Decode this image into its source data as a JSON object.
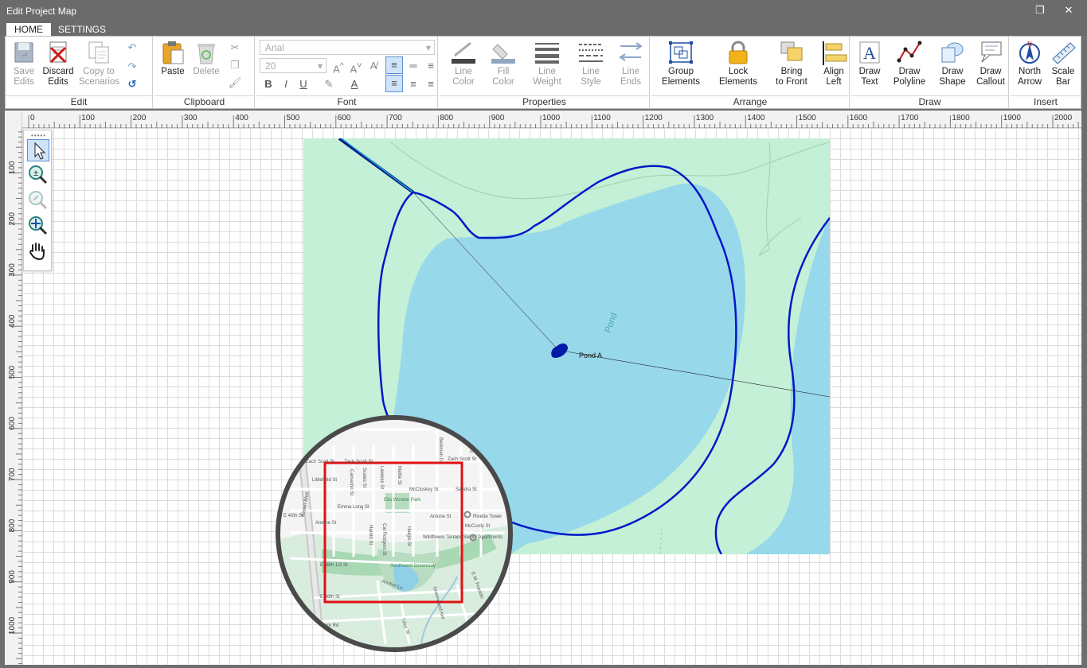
{
  "window": {
    "title": "Edit Project Map",
    "maximize_glyph": "❐",
    "close_glyph": "✕"
  },
  "tabs": [
    {
      "label": "HOME",
      "active": true
    },
    {
      "label": "SETTINGS",
      "active": false
    }
  ],
  "ribbon": {
    "edit": {
      "label": "Edit",
      "save": "Save\nEdits",
      "discard": "Discard\nEdits",
      "copy": "Copy to\nScenarios"
    },
    "clipboard": {
      "label": "Clipboard",
      "paste": "Paste",
      "delete": "Delete"
    },
    "font": {
      "label": "Font",
      "family": "Arial",
      "size": "20"
    },
    "properties": {
      "label": "Properties",
      "line_color": "Line\nColor",
      "fill_color": "Fill\nColor",
      "line_weight": "Line\nWeight",
      "line_style": "Line\nStyle",
      "line_ends": "Line\nEnds"
    },
    "arrange": {
      "label": "Arrange",
      "group": "Group\nElements",
      "lock": "Lock\nElements",
      "bring": "Bring\nto Front",
      "align": "Align\nLeft"
    },
    "draw": {
      "label": "Draw",
      "text": "Draw\nText",
      "polyline": "Draw\nPolyline",
      "shape": "Draw\nShape",
      "callout": "Draw\nCallout"
    },
    "insert": {
      "label": "Insert",
      "north": "North\nArrow",
      "scale": "Scale\nBar"
    }
  },
  "ruler": {
    "h_ticks": [
      "0",
      "100",
      "200",
      "300",
      "400",
      "500",
      "600",
      "700",
      "800",
      "900",
      "1000",
      "1100",
      "1200",
      "1300",
      "1400",
      "1500",
      "1600",
      "1700",
      "1800",
      "1900",
      "2000"
    ],
    "v_ticks": [
      "100",
      "200",
      "300",
      "400",
      "500",
      "600",
      "700",
      "800",
      "900",
      "1000"
    ]
  },
  "map": {
    "pond_label": "Pond",
    "node_label": "Pond A",
    "streets": [
      "Zach Scott St",
      "Zach Scott St",
      "Zach Scott St",
      "Littlefield St",
      "Camacho St",
      "Scales St",
      "Lawless St",
      "Mattie St",
      "McCloskey St",
      "Berkman Dr",
      "Sandra St",
      "Springdale Rd",
      "Emma Long St",
      "Ella Wooten Park",
      "Airport Blvd",
      "E 40th St",
      "Antone St",
      "Antone St",
      "Rivette Tower",
      "McCurdy St",
      "Wildflower Terrace Senior Apartments",
      "Cal Rodgers St",
      "Harold St",
      "Hargis St",
      "E 38th 1/2 St",
      "Southwest Greenway",
      "Manor Rd",
      "Anchor Ln",
      "E 38th St",
      "Greenwood Ave",
      "E M. Franklin",
      "Manor Rd",
      "Tilley St"
    ]
  }
}
